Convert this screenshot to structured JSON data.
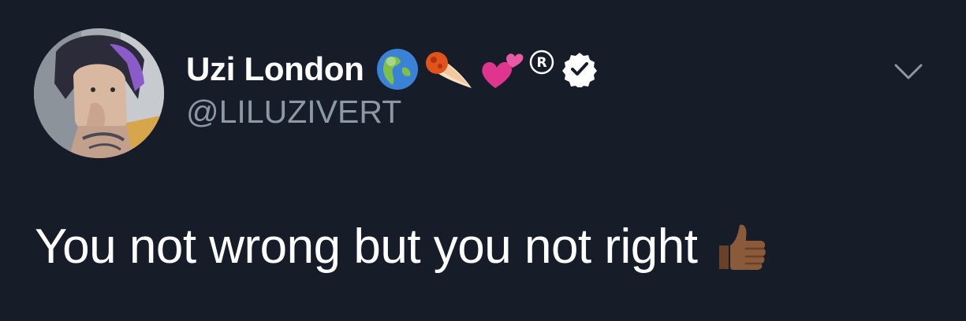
{
  "tweet": {
    "author": {
      "display_name": "Uzi London",
      "handle": "@LILUZIVERT",
      "badges": [
        "globe-emoji-icon",
        "comet-emoji-icon",
        "two-hearts-emoji-icon",
        "registered-icon",
        "verified-badge-icon"
      ]
    },
    "text": "You not wrong but you not right",
    "text_emoji": "thumbs-up-emoji-icon",
    "menu_icon": "chevron-down-icon"
  },
  "colors": {
    "background": "#161d29",
    "name": "#ffffff",
    "handle": "#8b98a5",
    "text": "#ffffff"
  }
}
